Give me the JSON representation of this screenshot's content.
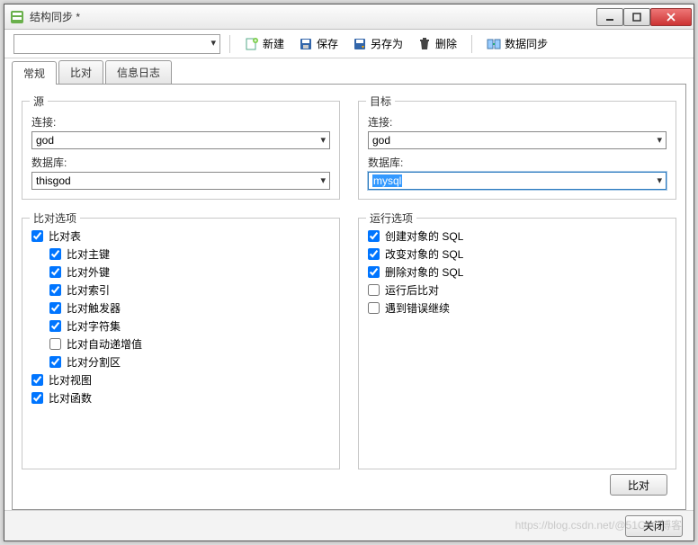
{
  "window": {
    "title": "结构同步 *"
  },
  "toolbar": {
    "new": "新建",
    "save": "保存",
    "saveas": "另存为",
    "delete": "删除",
    "datasync": "数据同步"
  },
  "tabs": {
    "general": "常规",
    "compare": "比对",
    "log": "信息日志"
  },
  "source": {
    "legend": "源",
    "conn_label": "连接:",
    "conn_value": "god",
    "db_label": "数据库:",
    "db_value": "thisgod"
  },
  "target": {
    "legend": "目标",
    "conn_label": "连接:",
    "conn_value": "god",
    "db_label": "数据库:",
    "db_value": "mysql"
  },
  "compare_opts": {
    "legend": "比对选项",
    "table": "比对表",
    "pk": "比对主键",
    "fk": "比对外键",
    "idx": "比对索引",
    "trigger": "比对触发器",
    "charset": "比对字符集",
    "autoinc": "比对自动递增值",
    "partition": "比对分割区",
    "view": "比对视图",
    "func": "比对函数"
  },
  "run_opts": {
    "legend": "运行选项",
    "create_sql": "创建对象的 SQL",
    "alter_sql": "改变对象的 SQL",
    "drop_sql": "删除对象的 SQL",
    "compare_after": "运行后比对",
    "continue_err": "遇到错误继续"
  },
  "buttons": {
    "compare": "比对",
    "close": "关闭"
  },
  "watermark": "https://blog.csdn.net/@51CTO博客"
}
